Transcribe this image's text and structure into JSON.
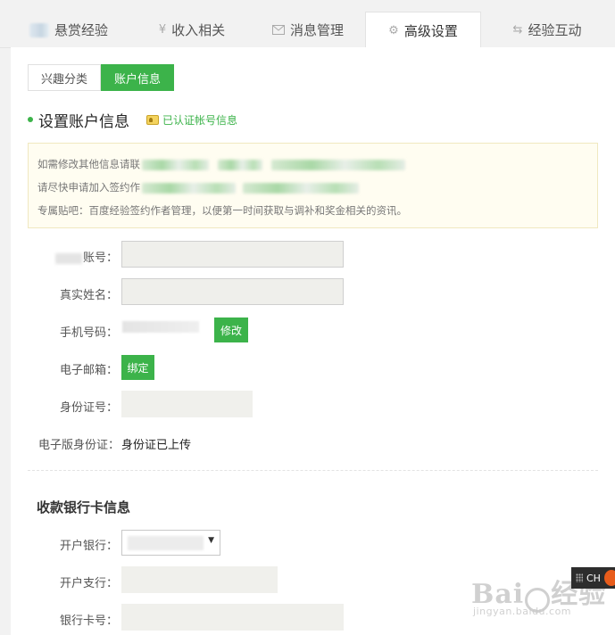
{
  "top_tabs": [
    {
      "label": "悬赏经验",
      "icon": "blurred-icon"
    },
    {
      "label": "收入相关",
      "icon": "yen-icon"
    },
    {
      "label": "消息管理",
      "icon": "mail-icon"
    },
    {
      "label": "高级设置",
      "icon": "gear-icon",
      "active": true
    },
    {
      "label": "经验互动",
      "icon": "exchange-icon"
    }
  ],
  "sub_tabs": [
    {
      "label": "兴趣分类",
      "active": false
    },
    {
      "label": "账户信息",
      "active": true
    }
  ],
  "section": {
    "title": "设置账户信息",
    "verified_link": "已认证帐号信息"
  },
  "notice": {
    "line1": "如需修改其他信息请联",
    "line2": "请尽快申请加入签约作",
    "line3": "专属贴吧：百度经验签约作者管理，以便第一时间获取与调补和奖金相关的资讯。"
  },
  "form": {
    "account_label": "账号：",
    "realname_label": "真实姓名：",
    "phone_label": "手机号码：",
    "phone_button": "修改",
    "email_label": "电子邮箱：",
    "email_button": "绑定",
    "id_label": "身份证号：",
    "eid_label": "电子版身份证：",
    "eid_value": "身份证已上传"
  },
  "bank": {
    "title": "收款银行卡信息",
    "bank_label": "开户银行：",
    "branch_label": "开户支行：",
    "card_label": "银行卡号："
  },
  "side_widget": {
    "label": "CH"
  },
  "watermark": {
    "main_left": "Bai",
    "main_right": "经验",
    "sub": "jingyan.baidu.com"
  },
  "colors": {
    "accent": "#3cb34a",
    "notice_bg": "#fffdf1",
    "tab_bg": "#f2f2f2"
  }
}
